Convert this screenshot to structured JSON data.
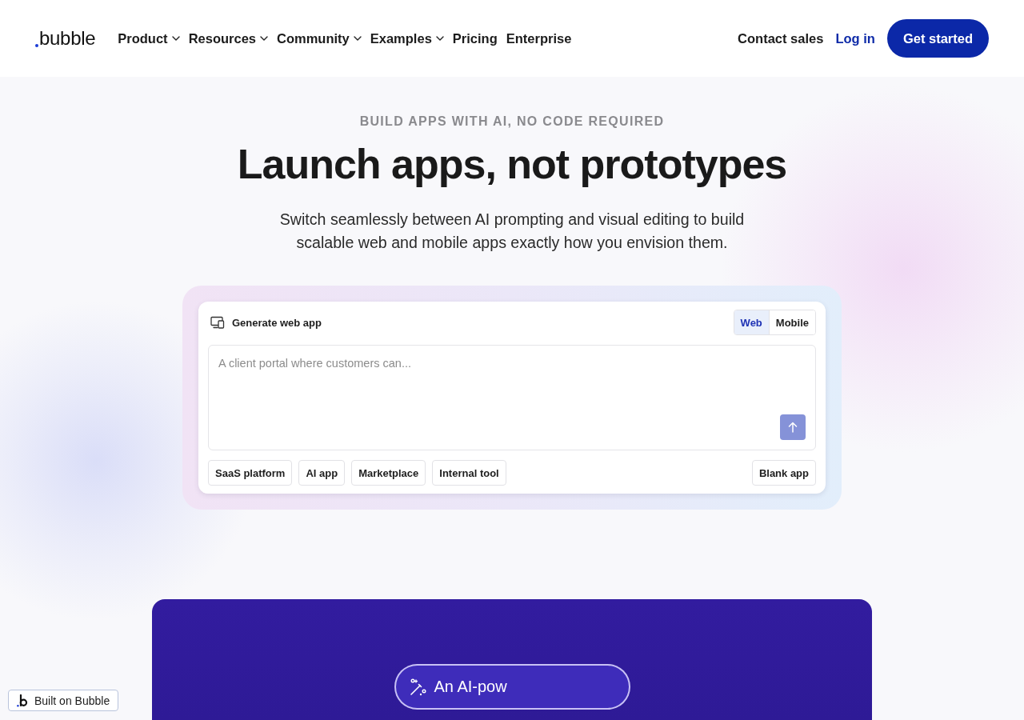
{
  "nav": {
    "logo": "bubble",
    "items": [
      {
        "label": "Product",
        "has_menu": true
      },
      {
        "label": "Resources",
        "has_menu": true
      },
      {
        "label": "Community",
        "has_menu": true
      },
      {
        "label": "Examples",
        "has_menu": true
      },
      {
        "label": "Pricing",
        "has_menu": false
      },
      {
        "label": "Enterprise",
        "has_menu": false
      }
    ],
    "contact": "Contact sales",
    "login": "Log in",
    "cta": "Get started"
  },
  "hero": {
    "eyebrow": "BUILD APPS WITH AI, NO CODE REQUIRED",
    "title": "Launch apps, not prototypes",
    "subtitle": "Switch seamlessly between AI prompting and visual editing to build scalable web and mobile apps exactly how you envision them."
  },
  "generator": {
    "title": "Generate web app",
    "modes": [
      {
        "label": "Web",
        "selected": true
      },
      {
        "label": "Mobile",
        "selected": false
      }
    ],
    "prompt": {
      "placeholder": "A client portal where customers can..."
    },
    "templates": [
      "SaaS platform",
      "AI app",
      "Marketplace",
      "Internal tool"
    ],
    "blank_button": "Blank app"
  },
  "feature_section": {
    "pill": "An AI-pow"
  },
  "badge": {
    "label": "Built on Bubble"
  }
}
